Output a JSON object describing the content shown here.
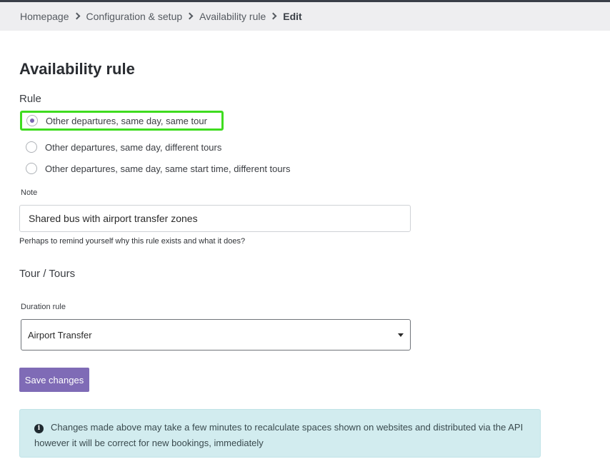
{
  "breadcrumb": {
    "items": [
      "Homepage",
      "Configuration & setup",
      "Availability rule"
    ],
    "current": "Edit"
  },
  "page_title": "Availability rule",
  "rule": {
    "heading": "Rule",
    "options": [
      "Other departures, same day, same tour",
      "Other departures, same day, different tours",
      "Other departures, same day, same start time, different tours"
    ],
    "selected_index": 0
  },
  "note": {
    "label": "Note",
    "value": "Shared bus with airport transfer zones",
    "help": "Perhaps to remind yourself why this rule exists and what it does?"
  },
  "tours_heading": "Tour / Tours",
  "duration": {
    "label": "Duration rule",
    "selected": "Airport Transfer"
  },
  "save_label": "Save changes",
  "alert": {
    "icon": "info-circle-icon",
    "text": "Changes made above may take a few minutes to recalculate spaces shown on websites and distributed via the API however it will be correct for new bookings, immediately"
  },
  "colors": {
    "accent": "#7f6bb6",
    "highlight": "#3fdc1f",
    "alert_bg": "#d2ecef"
  }
}
